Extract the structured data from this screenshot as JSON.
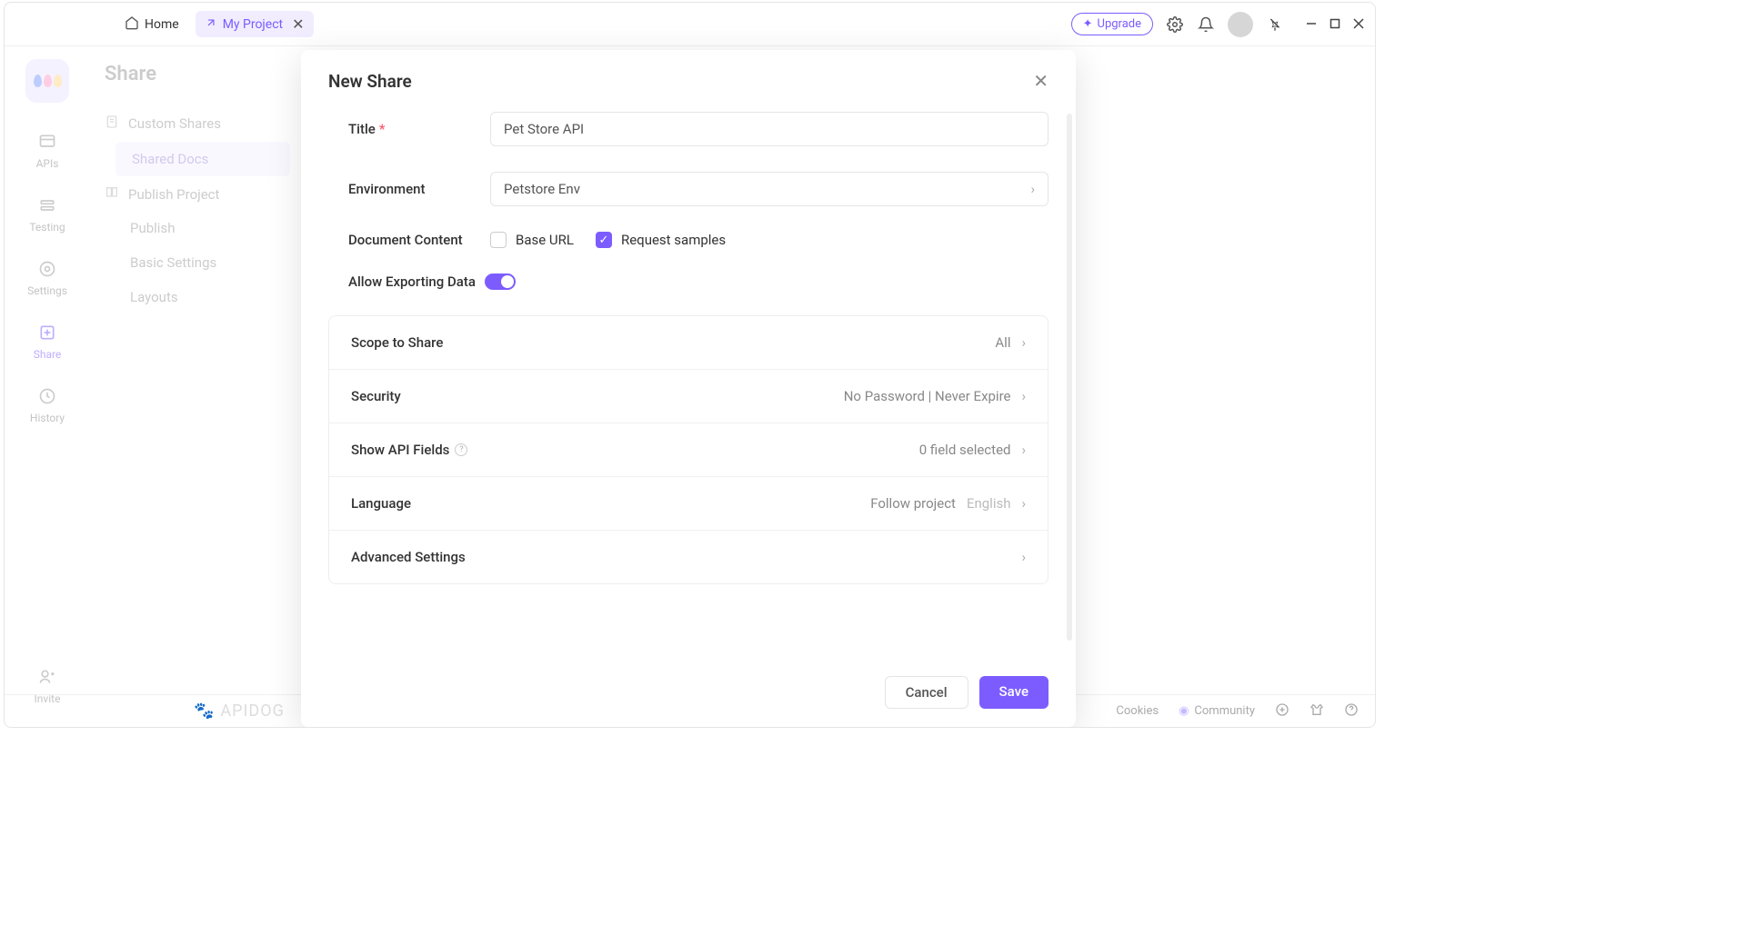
{
  "titlebar": {
    "home": "Home",
    "project_tab": "My Project",
    "upgrade": "Upgrade"
  },
  "rail": {
    "apis": "APIs",
    "testing": "Testing",
    "settings": "Settings",
    "share": "Share",
    "history": "History",
    "invite": "Invite"
  },
  "sidepanel": {
    "title": "Share",
    "custom_shares": "Custom Shares",
    "shared_docs": "Shared Docs",
    "publish_project": "Publish Project",
    "publish": "Publish",
    "basic_settings": "Basic Settings",
    "layouts": "Layouts"
  },
  "modal": {
    "title": "New Share",
    "labels": {
      "title": "Title",
      "environment": "Environment",
      "document_content": "Document Content",
      "allow_export": "Allow Exporting Data"
    },
    "fields": {
      "title_value": "Pet Store API",
      "environment_value": "Petstore Env",
      "base_url": "Base URL",
      "request_samples": "Request samples"
    },
    "settings": {
      "scope": {
        "label": "Scope to Share",
        "value": "All"
      },
      "security": {
        "label": "Security",
        "value": "No Password | Never Expire"
      },
      "api_fields": {
        "label": "Show API Fields",
        "value": "0 field selected"
      },
      "language": {
        "label": "Language",
        "value": "Follow project",
        "muted": "English"
      },
      "advanced": {
        "label": "Advanced Settings"
      }
    },
    "footer": {
      "cancel": "Cancel",
      "save": "Save"
    }
  },
  "bottombar": {
    "brand": "APIDOG",
    "cookies": "Cookies",
    "community": "Community"
  }
}
